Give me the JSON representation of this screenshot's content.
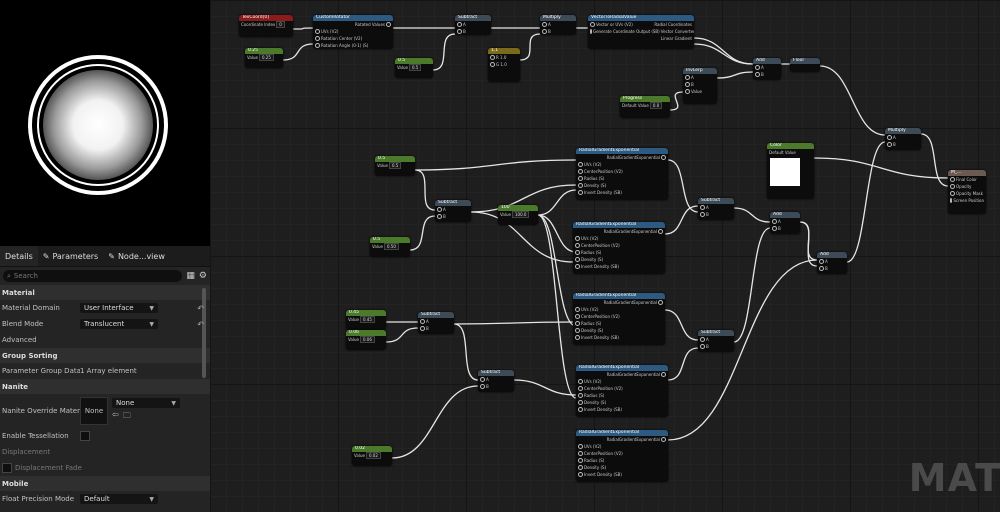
{
  "panel": {
    "tabs": [
      {
        "label": "Details",
        "icon": "details-icon"
      },
      {
        "label": "Parameters",
        "icon": "pencil-icon"
      },
      {
        "label": "Node...view",
        "icon": "pencil-icon"
      }
    ],
    "search_placeholder": "Search",
    "sections": {
      "material": "Material",
      "group_sorting": "Group Sorting",
      "nanite": "Nanite",
      "mobile": "Mobile"
    },
    "material_domain": {
      "label": "Material Domain",
      "value": "User Interface"
    },
    "blend_mode": {
      "label": "Blend Mode",
      "value": "Translucent"
    },
    "advanced": "Advanced",
    "parameter_group_data": {
      "label": "Parameter Group Data",
      "value": "1 Array element"
    },
    "nanite_override": {
      "label": "Nanite Override Mater...",
      "thumb": "None",
      "value": "None"
    },
    "enable_tessellation": "Enable Tessellation",
    "displacement": "Displacement",
    "displacement_fade": "Displacement Fade",
    "float_precision": {
      "label": "Float Precision Mode",
      "value": "Default"
    }
  },
  "graph": {
    "watermark": "MAT",
    "nodes": {
      "texcoord": {
        "title": "TexCoord[0]",
        "pin": "Coordinate Index",
        "val": "0"
      },
      "const_a": {
        "title": "0.25",
        "pin": "Value",
        "val": "0.25"
      },
      "custom_rotator": {
        "title": "CustomRotator",
        "pins": [
          "UVs (V2)",
          "Rotation Center (V2)",
          "Rotation Angle (0-1) (S)"
        ],
        "out": "Rotated Values"
      },
      "subtract_top": {
        "title": "Subtract",
        "pins": [
          "A",
          "B"
        ]
      },
      "const_b": {
        "title": "0.5",
        "pin": "Value",
        "val": "0.5"
      },
      "const_v2": {
        "title": "1,1",
        "pins": [
          "R 1.0",
          "G 1.0"
        ]
      },
      "multiply_top": {
        "title": "Multiply",
        "pins": [
          "A",
          "B"
        ]
      },
      "vector_to_radial": {
        "title": "VectorToRadialValue",
        "pins": [
          "Vector or UVs (V2)",
          "Generate Coordinate Output (SB)"
        ],
        "outs": [
          "Radial Coordinates",
          "Vector Converted to Angle",
          "Linear Gradient"
        ]
      },
      "invlerp": {
        "title": "InvLerp",
        "pins": [
          "A",
          "B",
          "Value"
        ]
      },
      "progress": {
        "title": "Progress",
        "pin": "Default Value",
        "val": "0.0"
      },
      "add_top": {
        "title": "Add",
        "pins": [
          "A",
          "B"
        ]
      },
      "floor": {
        "title": "Floor"
      },
      "multiply_right": {
        "title": "Multiply",
        "pins": [
          "A",
          "B"
        ]
      },
      "color": {
        "title": "Color",
        "pin": "Default Value"
      },
      "result": {
        "title": "M_...",
        "pins": [
          "Final Color",
          "Opacity",
          "Opacity Mask",
          "Screen Position"
        ]
      },
      "const_c": {
        "title": "0.5",
        "pin": "Value",
        "val": "0.5"
      },
      "const_d": {
        "title": "0.5",
        "pin": "Value",
        "val": "0.50"
      },
      "subtract_mid": {
        "title": "Subtract",
        "pins": [
          "A",
          "B"
        ]
      },
      "const_100": {
        "title": "100",
        "pin": "Value",
        "val": "100.0"
      },
      "radial1": {
        "title": "RadialGradientExponential",
        "pins": [
          "UVs (V2)",
          "CenterPosition (V2)",
          "Radius (S)",
          "Density (S)",
          "Invert Density (SB)"
        ],
        "out": "RadialGradientExponential"
      },
      "radial2": {
        "title": "RadialGradientExponential",
        "pins": [
          "UVs (V2)",
          "CenterPosition (V2)",
          "Radius (S)",
          "Density (S)",
          "Invert Density (SB)"
        ],
        "out": "RadialGradientExponential"
      },
      "radial3": {
        "title": "RadialGradientExponential",
        "pins": [
          "UVs (V2)",
          "CenterPosition (V2)",
          "Radius (S)",
          "Density (S)",
          "Invert Density (SB)"
        ],
        "out": "RadialGradientExponential"
      },
      "radial4": {
        "title": "RadialGradientExponential",
        "pins": [
          "UVs (V2)",
          "CenterPosition (V2)",
          "Radius (S)",
          "Density (S)",
          "Invert Density (SB)"
        ],
        "out": "RadialGradientExponential"
      },
      "radial5": {
        "title": "RadialGradientExponential",
        "pins": [
          "UVs (V2)",
          "CenterPosition (V2)",
          "Radius (S)",
          "Density (S)",
          "Invert Density (SB)"
        ],
        "out": "RadialGradientExponential"
      },
      "subtract_r1": {
        "title": "Subtract",
        "pins": [
          "A",
          "B"
        ]
      },
      "add_mid": {
        "title": "Add",
        "pins": [
          "A",
          "B"
        ]
      },
      "add_low": {
        "title": "Add",
        "pins": [
          "A",
          "B"
        ]
      },
      "subtract_r2": {
        "title": "Subtract",
        "pins": [
          "A",
          "B"
        ]
      },
      "const_e": {
        "title": "0.45",
        "pin": "Value",
        "val": "0.45"
      },
      "const_f": {
        "title": "0.06",
        "pin": "Value",
        "val": "0.06"
      },
      "subtract_low1": {
        "title": "Subtract",
        "pins": [
          "A",
          "B"
        ]
      },
      "subtract_low2": {
        "title": "Subtract",
        "pins": [
          "A",
          "B"
        ]
      },
      "const_g": {
        "title": "0.02",
        "pin": "Value",
        "val": "0.02"
      }
    }
  },
  "colors": {
    "header_param": "#4a7a2a",
    "header_func": "#2d5a80",
    "header_texcoord": "#8a1c1c",
    "header_vector": "#7a6a1a",
    "header_math": "#3d4a57",
    "header_result": "#6a5a52",
    "wire": "#e6e6e6"
  }
}
